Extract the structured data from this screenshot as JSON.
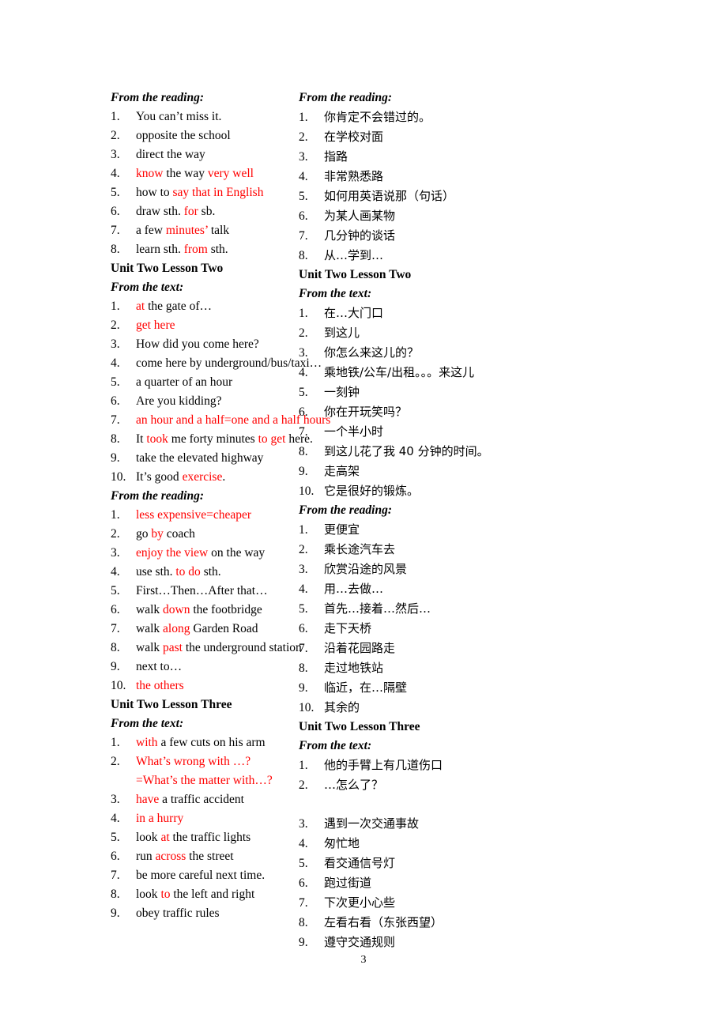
{
  "page": {
    "page_number": "3",
    "accent_color": "#ff0000"
  },
  "left_column": {
    "blocks": [
      {
        "kind": "section-heading",
        "label": "From the reading:",
        "items": [
          {
            "num": "1.",
            "parts": [
              {
                "t": "You can’t miss it.",
                "c": "k"
              }
            ]
          },
          {
            "num": "2.",
            "parts": [
              {
                "t": "opposite the school",
                "c": "k"
              }
            ]
          },
          {
            "num": "3.",
            "parts": [
              {
                "t": "direct the way",
                "c": "k"
              }
            ]
          },
          {
            "num": "4.",
            "parts": [
              {
                "t": "know",
                "c": "r"
              },
              {
                "t": " the way ",
                "c": "k"
              },
              {
                "t": "very well",
                "c": "r"
              }
            ]
          },
          {
            "num": "5.",
            "parts": [
              {
                "t": "how to ",
                "c": "k"
              },
              {
                "t": "say that in English",
                "c": "r"
              }
            ]
          },
          {
            "num": "6.",
            "parts": [
              {
                "t": "draw sth. ",
                "c": "k"
              },
              {
                "t": "for",
                "c": "r"
              },
              {
                "t": " sb.",
                "c": "k"
              }
            ]
          },
          {
            "num": "7.",
            "parts": [
              {
                "t": "a few ",
                "c": "k"
              },
              {
                "t": "minutes’",
                "c": "r"
              },
              {
                "t": " talk",
                "c": "k"
              }
            ]
          },
          {
            "num": "8.",
            "parts": [
              {
                "t": "learn sth. ",
                "c": "k"
              },
              {
                "t": "from",
                "c": "r"
              },
              {
                "t": " sth.",
                "c": "k"
              }
            ]
          }
        ]
      },
      {
        "kind": "unit-heading",
        "label": "Unit Two Lesson Two",
        "items": []
      },
      {
        "kind": "section-heading",
        "label": "From the text:",
        "items": [
          {
            "num": "1.",
            "parts": [
              {
                "t": "at",
                "c": "r"
              },
              {
                "t": " the gate of…",
                "c": "k"
              }
            ]
          },
          {
            "num": "2.",
            "parts": [
              {
                "t": "get here",
                "c": "r"
              }
            ]
          },
          {
            "num": "3.",
            "parts": [
              {
                "t": "How did you come here?",
                "c": "k"
              }
            ]
          },
          {
            "num": "4.",
            "parts": [
              {
                "t": "come here by underground/bus/taxi…",
                "c": "k"
              }
            ]
          },
          {
            "num": "5.",
            "parts": [
              {
                "t": "a quarter of an hour",
                "c": "k"
              }
            ]
          },
          {
            "num": "6.",
            "parts": [
              {
                "t": "Are you kidding?",
                "c": "k"
              }
            ]
          },
          {
            "num": "7.",
            "parts": [
              {
                "t": "an hour and a half=one and a half hours",
                "c": "r"
              }
            ]
          },
          {
            "num": "8.",
            "parts": [
              {
                "t": "It ",
                "c": "k"
              },
              {
                "t": "took",
                "c": "r"
              },
              {
                "t": " me forty minutes ",
                "c": "k"
              },
              {
                "t": "to get",
                "c": "r"
              },
              {
                "t": " here.",
                "c": "k"
              }
            ]
          },
          {
            "num": "9.",
            "parts": [
              {
                "t": "take the elevated highway",
                "c": "k"
              }
            ]
          },
          {
            "num": "10.",
            "parts": [
              {
                "t": "It’s good ",
                "c": "k"
              },
              {
                "t": "exercise",
                "c": "r"
              },
              {
                "t": ".",
                "c": "k"
              }
            ]
          }
        ]
      },
      {
        "kind": "section-heading",
        "label": "From the reading:",
        "items": [
          {
            "num": "1.",
            "parts": [
              {
                "t": "less expensive=cheaper",
                "c": "r"
              }
            ]
          },
          {
            "num": "2.",
            "parts": [
              {
                "t": "go ",
                "c": "k"
              },
              {
                "t": "by",
                "c": "r"
              },
              {
                "t": " coach",
                "c": "k"
              }
            ]
          },
          {
            "num": "3.",
            "parts": [
              {
                "t": "enjoy the view",
                "c": "r"
              },
              {
                "t": " on the way",
                "c": "k"
              }
            ]
          },
          {
            "num": "4.",
            "parts": [
              {
                "t": "use sth. ",
                "c": "k"
              },
              {
                "t": "to do",
                "c": "r"
              },
              {
                "t": " sth.",
                "c": "k"
              }
            ]
          },
          {
            "num": "5.",
            "parts": [
              {
                "t": "First…Then…After that…",
                "c": "k"
              }
            ]
          },
          {
            "num": "6.",
            "parts": [
              {
                "t": "walk ",
                "c": "k"
              },
              {
                "t": "down",
                "c": "r"
              },
              {
                "t": " the footbridge",
                "c": "k"
              }
            ]
          },
          {
            "num": "7.",
            "parts": [
              {
                "t": "walk ",
                "c": "k"
              },
              {
                "t": "along",
                "c": "r"
              },
              {
                "t": " Garden Road",
                "c": "k"
              }
            ]
          },
          {
            "num": "8.",
            "parts": [
              {
                "t": "walk ",
                "c": "k"
              },
              {
                "t": "past",
                "c": "r"
              },
              {
                "t": " the underground station",
                "c": "k"
              }
            ]
          },
          {
            "num": "9.",
            "parts": [
              {
                "t": "next to…",
                "c": "k"
              }
            ]
          },
          {
            "num": "10.",
            "parts": [
              {
                "t": "the others",
                "c": "r"
              }
            ]
          }
        ]
      },
      {
        "kind": "unit-heading",
        "label": "Unit Two Lesson Three",
        "items": []
      },
      {
        "kind": "section-heading",
        "label": "From the text:",
        "items": [
          {
            "num": "1.",
            "parts": [
              {
                "t": "with",
                "c": "r"
              },
              {
                "t": " a few cuts on his arm",
                "c": "k"
              }
            ]
          },
          {
            "num": "2.",
            "parts": [
              {
                "t": "What’s wrong with …?",
                "c": "r"
              }
            ],
            "continuation": [
              {
                "t": "=What’s the matter with…?",
                "c": "r"
              }
            ]
          },
          {
            "num": "3.",
            "parts": [
              {
                "t": "have",
                "c": "r"
              },
              {
                "t": " a traffic accident",
                "c": "k"
              }
            ]
          },
          {
            "num": "4.",
            "parts": [
              {
                "t": "in a hurry",
                "c": "r"
              }
            ]
          },
          {
            "num": "5.",
            "parts": [
              {
                "t": "look ",
                "c": "k"
              },
              {
                "t": "at",
                "c": "r"
              },
              {
                "t": " the traffic lights",
                "c": "k"
              }
            ]
          },
          {
            "num": "6.",
            "parts": [
              {
                "t": "run ",
                "c": "k"
              },
              {
                "t": "across",
                "c": "r"
              },
              {
                "t": " the street",
                "c": "k"
              }
            ]
          },
          {
            "num": "7.",
            "parts": [
              {
                "t": "be more careful next time.",
                "c": "k"
              }
            ]
          },
          {
            "num": "8.",
            "parts": [
              {
                "t": "look ",
                "c": "k"
              },
              {
                "t": "to",
                "c": "r"
              },
              {
                "t": " the left and right",
                "c": "k"
              }
            ]
          },
          {
            "num": "9.",
            "parts": [
              {
                "t": "obey traffic rules",
                "c": "k"
              }
            ]
          }
        ]
      }
    ]
  },
  "right_column": {
    "blocks": [
      {
        "kind": "section-heading",
        "label": "From the reading:",
        "items": [
          {
            "num": "1.",
            "parts": [
              {
                "t": "你肯定不会错过的。",
                "c": "cn"
              }
            ]
          },
          {
            "num": "2.",
            "parts": [
              {
                "t": "在学校对面",
                "c": "cn"
              }
            ]
          },
          {
            "num": "3.",
            "parts": [
              {
                "t": "指路",
                "c": "cn"
              }
            ]
          },
          {
            "num": "4.",
            "parts": [
              {
                "t": "非常熟悉路",
                "c": "cn"
              }
            ]
          },
          {
            "num": "5.",
            "parts": [
              {
                "t": "如何用英语说那（句话）",
                "c": "cn"
              }
            ]
          },
          {
            "num": "6.",
            "parts": [
              {
                "t": "为某人画某物",
                "c": "cn"
              }
            ]
          },
          {
            "num": "7.",
            "parts": [
              {
                "t": "几分钟的谈话",
                "c": "cn"
              }
            ]
          },
          {
            "num": "8.",
            "parts": [
              {
                "t": "从…学到…",
                "c": "cn"
              }
            ]
          }
        ]
      },
      {
        "kind": "unit-heading",
        "label": "Unit Two Lesson Two",
        "items": []
      },
      {
        "kind": "section-heading",
        "label": "From the text:",
        "items": [
          {
            "num": "1.",
            "parts": [
              {
                "t": "在…大门口",
                "c": "cn"
              }
            ]
          },
          {
            "num": "2.",
            "parts": [
              {
                "t": "到这儿",
                "c": "cn"
              }
            ]
          },
          {
            "num": "3.",
            "parts": [
              {
                "t": "你怎么来这儿的？",
                "c": "cn"
              }
            ]
          },
          {
            "num": "4.",
            "parts": [
              {
                "t": "乘地铁/公车/出租。。。来这儿",
                "c": "cn"
              }
            ]
          },
          {
            "num": "5.",
            "parts": [
              {
                "t": "一刻钟",
                "c": "cn"
              }
            ]
          },
          {
            "num": "6.",
            "parts": [
              {
                "t": "你在开玩笑吗？",
                "c": "cn"
              }
            ]
          },
          {
            "num": "7.",
            "parts": [
              {
                "t": "一个半小时",
                "c": "cn"
              }
            ]
          },
          {
            "num": "8.",
            "parts": [
              {
                "t": "到这儿花了我 40 分钟的时间。",
                "c": "cn"
              }
            ]
          },
          {
            "num": "9.",
            "parts": [
              {
                "t": "走高架",
                "c": "cn"
              }
            ]
          },
          {
            "num": "10.",
            "parts": [
              {
                "t": "它是很好的锻炼。",
                "c": "cn"
              }
            ]
          }
        ]
      },
      {
        "kind": "section-heading",
        "label": "From the reading:",
        "items": [
          {
            "num": "1.",
            "parts": [
              {
                "t": "更便宜",
                "c": "cn"
              }
            ]
          },
          {
            "num": "2.",
            "parts": [
              {
                "t": "乘长途汽车去",
                "c": "cn"
              }
            ]
          },
          {
            "num": "3.",
            "parts": [
              {
                "t": "欣赏沿途的风景",
                "c": "cn"
              }
            ]
          },
          {
            "num": "4.",
            "parts": [
              {
                "t": "用…去做…",
                "c": "cn"
              }
            ]
          },
          {
            "num": "5.",
            "parts": [
              {
                "t": "首先…接着…然后…",
                "c": "cn"
              }
            ]
          },
          {
            "num": "6.",
            "parts": [
              {
                "t": "走下天桥",
                "c": "cn"
              }
            ]
          },
          {
            "num": "7.",
            "parts": [
              {
                "t": "沿着花园路走",
                "c": "cn"
              }
            ]
          },
          {
            "num": "8.",
            "parts": [
              {
                "t": "走过地铁站",
                "c": "cn"
              }
            ]
          },
          {
            "num": "9.",
            "parts": [
              {
                "t": "临近，在…隔壁",
                "c": "cn"
              }
            ]
          },
          {
            "num": "10.",
            "parts": [
              {
                "t": "其余的",
                "c": "cn"
              }
            ]
          }
        ]
      },
      {
        "kind": "unit-heading",
        "label": "Unit Two Lesson Three",
        "items": []
      },
      {
        "kind": "section-heading",
        "label": "From the text:",
        "items": [
          {
            "num": "1.",
            "parts": [
              {
                "t": "他的手臂上有几道伤口",
                "c": "cn"
              }
            ]
          },
          {
            "num": "2.",
            "parts": [
              {
                "t": "…怎么了？",
                "c": "cn"
              }
            ],
            "blank_after": true
          },
          {
            "num": "3.",
            "parts": [
              {
                "t": "遇到一次交通事故",
                "c": "cn"
              }
            ]
          },
          {
            "num": "4.",
            "parts": [
              {
                "t": "匆忙地",
                "c": "cn"
              }
            ]
          },
          {
            "num": "5.",
            "parts": [
              {
                "t": "看交通信号灯",
                "c": "cn"
              }
            ]
          },
          {
            "num": "6.",
            "parts": [
              {
                "t": "跑过街道",
                "c": "cn"
              }
            ]
          },
          {
            "num": "7.",
            "parts": [
              {
                "t": "下次更小心些",
                "c": "cn"
              }
            ]
          },
          {
            "num": "8.",
            "parts": [
              {
                "t": "左看右看（东张西望）",
                "c": "cn"
              }
            ]
          },
          {
            "num": "9.",
            "parts": [
              {
                "t": "遵守交通规则",
                "c": "cn"
              }
            ]
          }
        ]
      }
    ]
  }
}
